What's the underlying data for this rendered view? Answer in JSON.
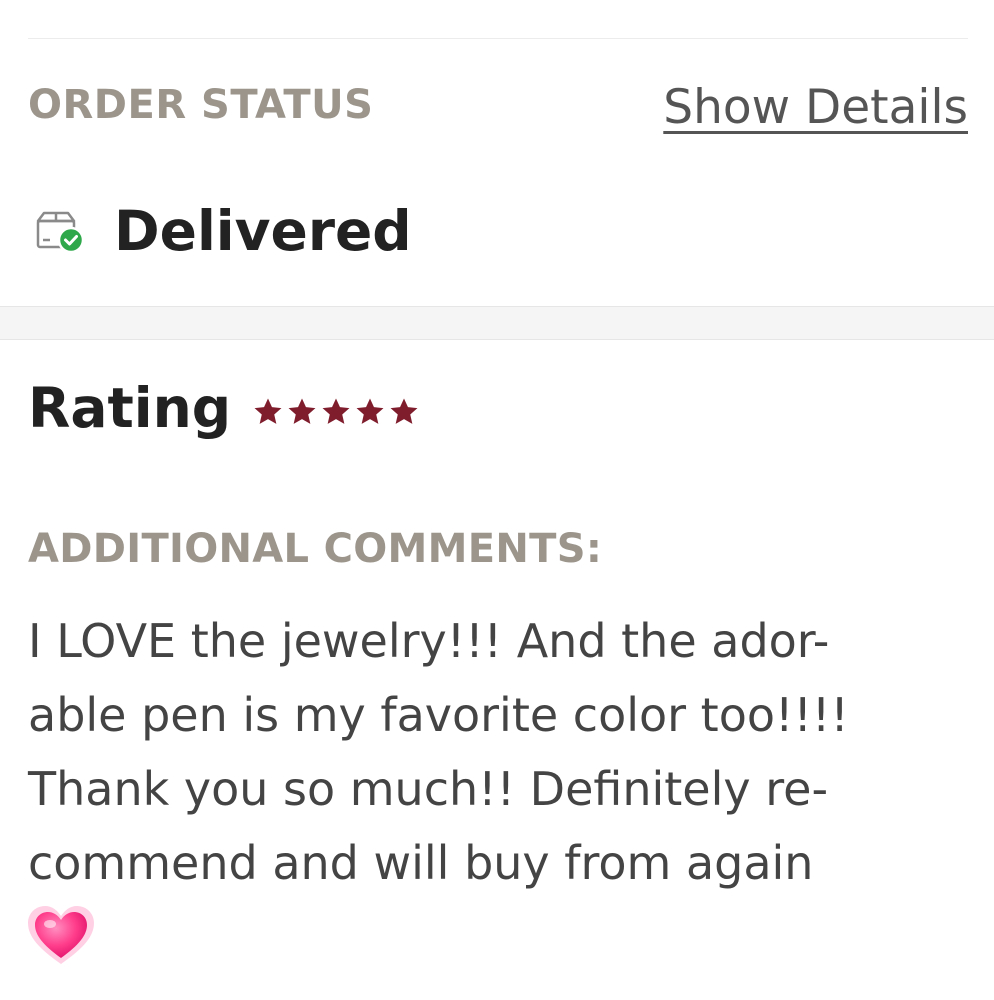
{
  "order": {
    "status_label": "ORDER STATUS",
    "show_details_label": "Show Details",
    "status_value": "Delivered",
    "status_icon": "package-delivered-icon"
  },
  "rating": {
    "label": "Rating",
    "stars": 5,
    "max_stars": 5,
    "star_color": "#7f1d2d"
  },
  "comments": {
    "label": "ADDITIONAL COMMENTS:",
    "lines": [
      "I LOVE the jewelry!!! And the ador-",
      "able pen is my favorite color too!!!!",
      "Thank you so much!! Definitely re-",
      "commend and will buy from again"
    ],
    "emoji": "heart-emoji"
  },
  "colors": {
    "muted_label": "#9b958c",
    "delivered_check": "#2ea84a",
    "heart_pink": "#ff3d8b"
  }
}
